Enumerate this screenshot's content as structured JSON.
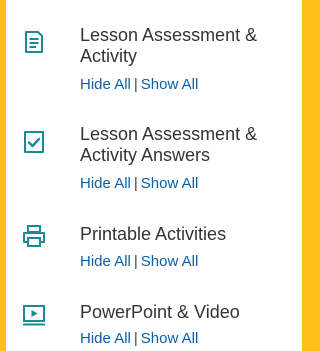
{
  "colors": {
    "accent": "#1a8a98",
    "link": "#0b5ea8",
    "frame": "#fdbf18"
  },
  "sections": [
    {
      "icon": "document-lines-icon",
      "title_line1": "Lesson Assessment &",
      "title_line2": "Activity",
      "hide_label": "Hide All",
      "separator": "|",
      "show_label": "Show All"
    },
    {
      "icon": "checked-document-icon",
      "title_line1": "Lesson Assessment &",
      "title_line2": "Activity Answers",
      "hide_label": "Hide All",
      "separator": "|",
      "show_label": "Show All"
    },
    {
      "icon": "printer-icon",
      "title_line1": "Printable Activities",
      "hide_label": "Hide All",
      "separator": "|",
      "show_label": "Show All"
    },
    {
      "icon": "video-play-icon",
      "title_line1": "PowerPoint & Video",
      "hide_label": "Hide All",
      "separator": "|",
      "show_label": "Show All"
    }
  ]
}
